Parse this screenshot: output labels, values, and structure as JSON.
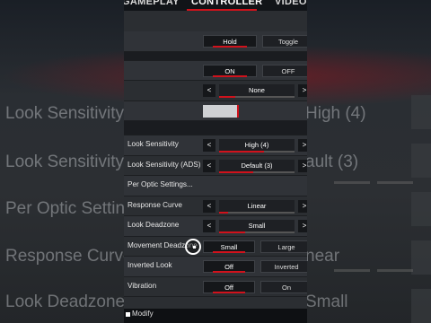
{
  "tabs": [
    {
      "label": "GAMEPLAY"
    },
    {
      "label": "CONTROLLER",
      "active": true
    },
    {
      "label": "VIDEO"
    }
  ],
  "background": {
    "rows": [
      {
        "left": "Look Sensitivity",
        "right": "High (4)"
      },
      {
        "left": "Look Sensitivity",
        "right": "ault (3)"
      },
      {
        "left": "Per Optic Setting",
        "right": ""
      },
      {
        "left": "Response Curve",
        "right": "near"
      },
      {
        "left": "Look Deadzone",
        "right": "Small"
      }
    ]
  },
  "settings": {
    "row1": {
      "left": "Hold",
      "right": "Toggle",
      "selected": "left"
    },
    "row2": {
      "left": "ON",
      "right": "OFF",
      "selected": "left"
    },
    "row3": {
      "value": "None"
    },
    "row4": {
      "slider_fraction": 0.36
    },
    "look_sensitivity": {
      "label": "Look Sensitivity",
      "value": "High (4)"
    },
    "look_sensitivity_ads": {
      "label": "Look Sensitivity (ADS)",
      "value": "Default (3)"
    },
    "per_optic": {
      "label": "Per Optic Settings..."
    },
    "response_curve": {
      "label": "Response Curve",
      "value": "Linear"
    },
    "look_deadzone": {
      "label": "Look Deadzone",
      "value": "Small"
    },
    "movement_deadzone": {
      "label": "Movement Deadzone",
      "left": "Small",
      "right": "Large",
      "selected": "left"
    },
    "inverted_look": {
      "label": "Inverted Look",
      "left": "Off",
      "right": "Inverted",
      "selected": "left"
    },
    "vibration": {
      "label": "Vibration",
      "left": "Off",
      "right": "On",
      "selected": "left"
    }
  },
  "arrows": {
    "left": "<",
    "right": ">"
  },
  "footer": {
    "hint": "Modify"
  },
  "colors": {
    "accent": "#d0121c",
    "panel": "#2b2e32"
  }
}
